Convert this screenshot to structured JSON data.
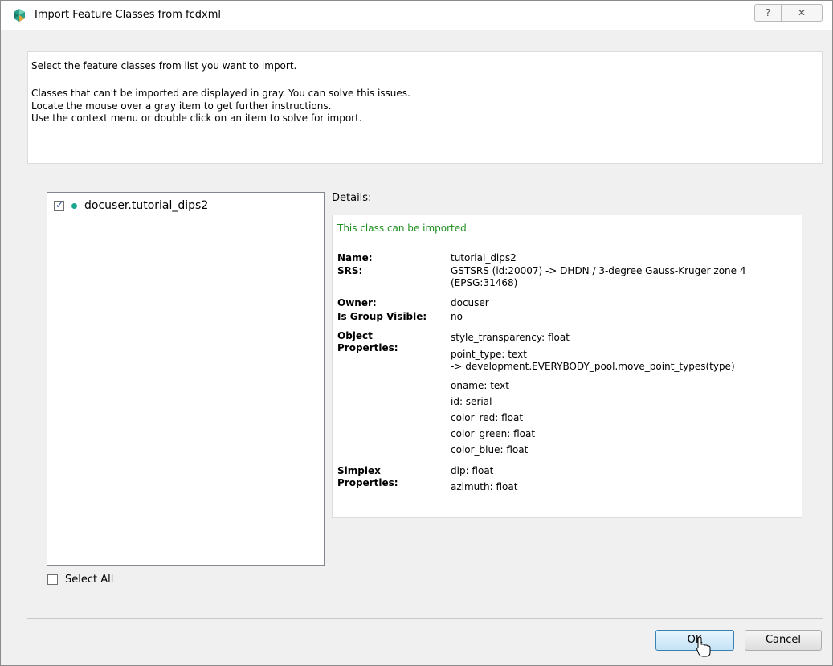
{
  "window": {
    "title": "Import Feature Classes from fcdxml",
    "help_label": "?",
    "close_label": "✕"
  },
  "info": {
    "line1": "Select the feature classes from list you want to import.",
    "line2": "Classes that can't be imported are displayed in gray. You can solve this issues.",
    "line3": "Locate the mouse over a gray item to get further instructions.",
    "line4": "Use the context menu or double click on an item to solve for import."
  },
  "class_list": {
    "items": [
      {
        "label": "docuser.tutorial_dips2",
        "checked": true,
        "status_color": "#1aa68e"
      }
    ]
  },
  "select_all": {
    "label": "Select All",
    "checked": false
  },
  "details": {
    "label": "Details:",
    "status": "This class can be imported.",
    "name_key": "Name:",
    "name_val": "tutorial_dips2",
    "srs_key": "SRS:",
    "srs_val1": "GSTSRS (id:20007) -> DHDN / 3-degree Gauss-Kruger zone 4",
    "srs_val2": "(EPSG:31468)",
    "owner_key": "Owner:",
    "owner_val": "docuser",
    "group_key": "Is Group Visible:",
    "group_val": "no",
    "objprops_key1": "Object",
    "objprops_key2": "Properties:",
    "object_properties": [
      "style_transparency: float",
      "point_type: text",
      "-> development.EVERYBODY_pool.move_point_types(type)",
      "oname: text",
      "id: serial",
      "color_red: float",
      "color_green: float",
      "color_blue: float"
    ],
    "simplex_key1": "Simplex",
    "simplex_key2": "Properties:",
    "simplex_properties": [
      "dip: float",
      "azimuth: float"
    ]
  },
  "buttons": {
    "ok": "OK",
    "cancel": "Cancel"
  },
  "colors": {
    "status_green": "#1e8f1e",
    "dot_teal": "#1aa68e",
    "ok_border": "#3c7fb1"
  }
}
